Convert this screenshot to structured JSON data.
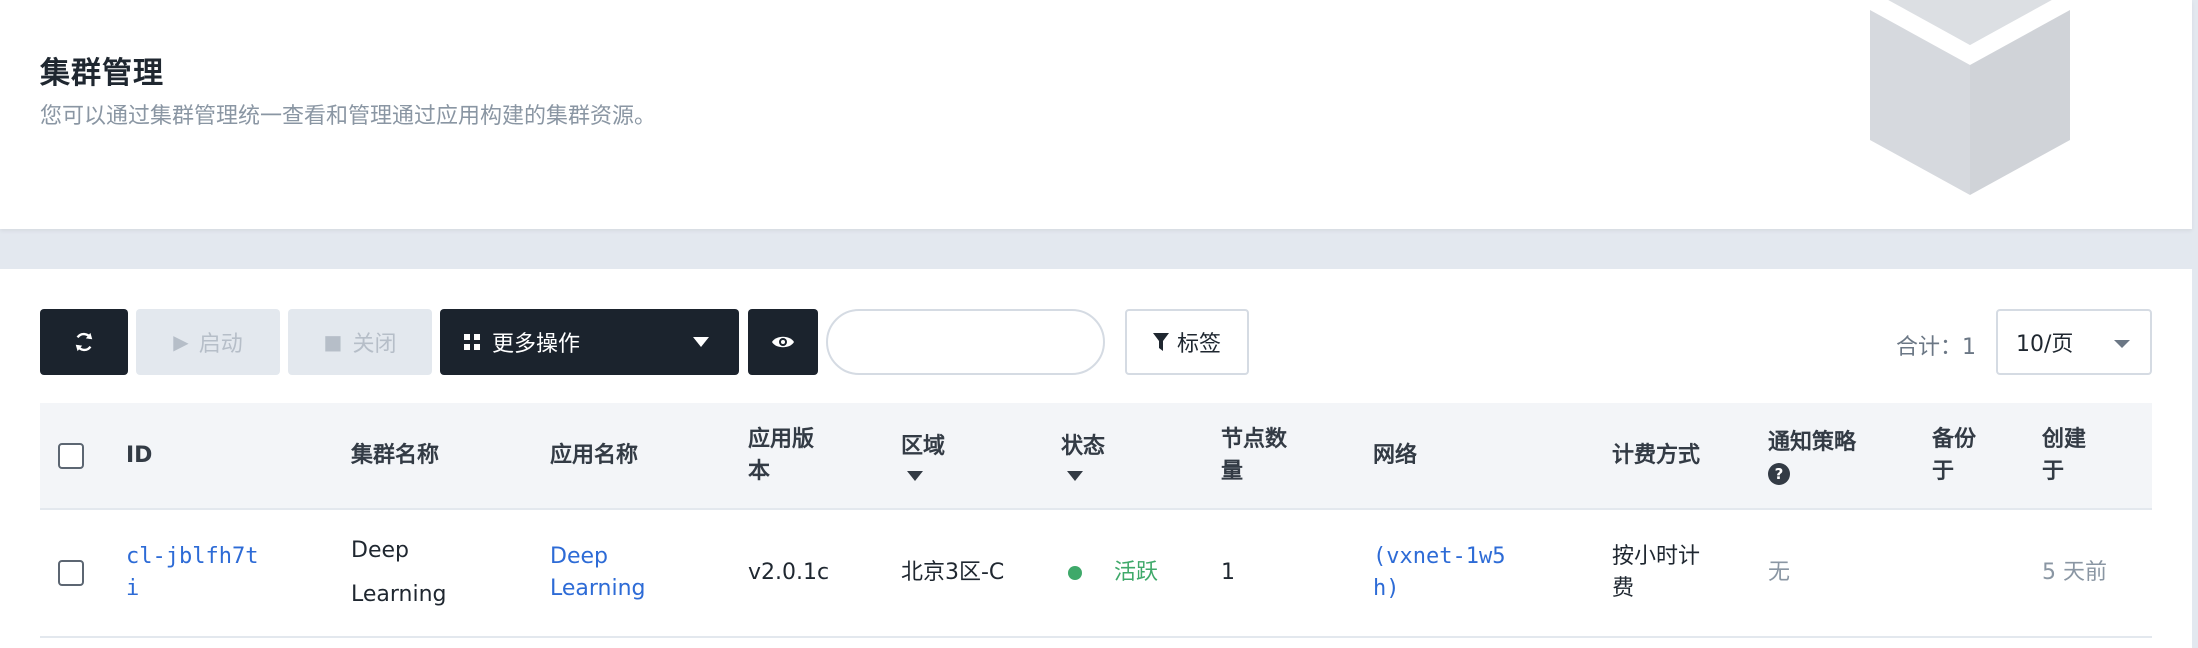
{
  "header": {
    "title": "集群管理",
    "subtitle": "您可以通过集群管理统一查看和管理通过应用构建的集群资源。"
  },
  "toolbar": {
    "start_label": "启动",
    "close_label": "关闭",
    "more_label": "更多操作",
    "search_placeholder": "",
    "tag_label": "标签",
    "total_label": "合计：1",
    "page_size": "10/页"
  },
  "icons": {
    "refresh": "refresh-icon",
    "play": "play-icon",
    "stop": "stop-icon",
    "grid": "grid-icon",
    "eye": "eye-icon",
    "filter": "filter-icon",
    "help": "question-circle-icon",
    "cube": "cube-icon"
  },
  "table": {
    "columns": {
      "id": "ID",
      "cluster_name": "集群名称",
      "app_name": "应用名称",
      "app_version_1": "应用版",
      "app_version_2": "本",
      "region": "区域",
      "status": "状态",
      "nodes_1": "节点数",
      "nodes_2": "量",
      "network": "网络",
      "billing": "计费方式",
      "notify": "通知策略",
      "backup_1": "备份",
      "backup_2": "于",
      "created_1": "创建",
      "created_2": "于"
    },
    "rows": [
      {
        "id_1": "cl-jblfh7t",
        "id_2": "i",
        "cluster_name_1": "Deep",
        "cluster_name_2": "Learning",
        "app_name_1": "Deep",
        "app_name_2": "Learning",
        "version": "v2.0.1c",
        "region": "北京3区-C",
        "status": "活跃",
        "nodes": "1",
        "network_1": "(vxnet-1w5",
        "network_2": "h)",
        "billing_1": "按小时计",
        "billing_2": "费",
        "notify": "无",
        "backup": "",
        "created": "5 天前"
      }
    ]
  },
  "colors": {
    "primary_dark": "#1b232d",
    "link": "#2d6bd6",
    "status_active": "#3fa96a",
    "muted": "#8a96a3"
  }
}
